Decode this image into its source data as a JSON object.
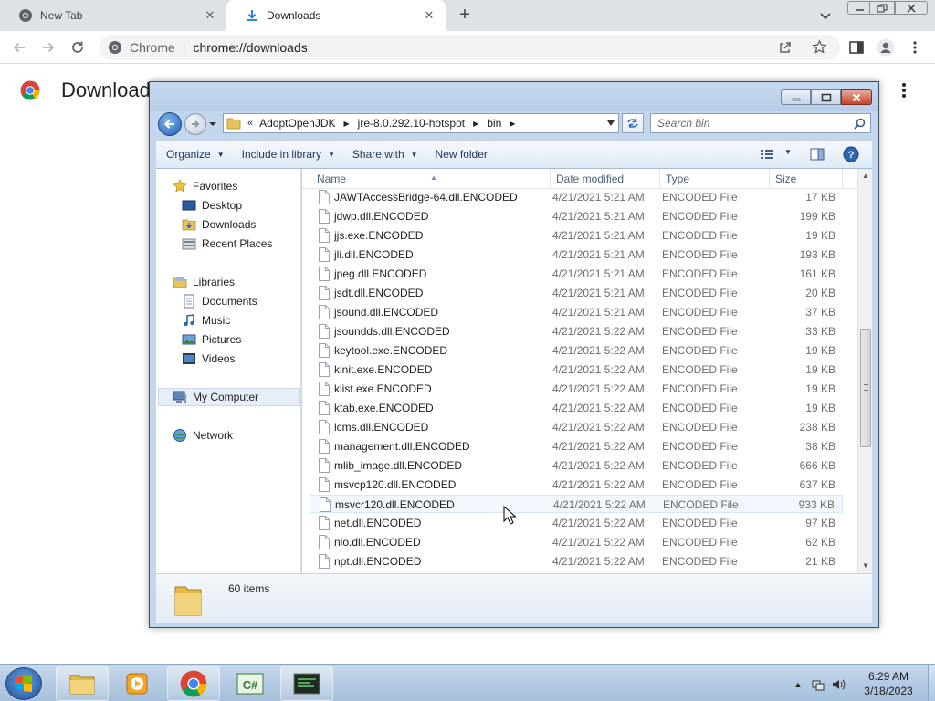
{
  "browser": {
    "tabs": [
      {
        "title": "New Tab",
        "state": "inactive"
      },
      {
        "title": "Downloads",
        "state": "active"
      }
    ],
    "omnibox": {
      "site_label": "Chrome",
      "separator": "|",
      "url": "chrome://downloads"
    }
  },
  "downloads_page": {
    "title": "Downloads"
  },
  "explorer": {
    "address": {
      "chevron": "«",
      "segments": [
        "AdoptOpenJDK",
        "jre-8.0.292.10-hotspot",
        "bin"
      ]
    },
    "search_placeholder": "Search bin",
    "commands": [
      {
        "label": "Organize",
        "has_menu": true
      },
      {
        "label": "Include in library",
        "has_menu": true
      },
      {
        "label": "Share with",
        "has_menu": true
      },
      {
        "label": "New folder",
        "has_menu": false
      }
    ],
    "nav": {
      "favorites": "Favorites",
      "desktop": "Desktop",
      "downloads": "Downloads",
      "recent": "Recent Places",
      "libraries": "Libraries",
      "documents": "Documents",
      "music": "Music",
      "pictures": "Pictures",
      "videos": "Videos",
      "computer": "My Computer",
      "network": "Network"
    },
    "columns": {
      "name": "Name",
      "date": "Date modified",
      "type": "Type",
      "size": "Size"
    },
    "files": [
      {
        "name": "JAWTAccessBridge-64.dll.ENCODED",
        "date": "4/21/2021 5:21 AM",
        "type": "ENCODED File",
        "size": "17 KB"
      },
      {
        "name": "jdwp.dll.ENCODED",
        "date": "4/21/2021 5:21 AM",
        "type": "ENCODED File",
        "size": "199 KB"
      },
      {
        "name": "jjs.exe.ENCODED",
        "date": "4/21/2021 5:21 AM",
        "type": "ENCODED File",
        "size": "19 KB"
      },
      {
        "name": "jli.dll.ENCODED",
        "date": "4/21/2021 5:21 AM",
        "type": "ENCODED File",
        "size": "193 KB"
      },
      {
        "name": "jpeg.dll.ENCODED",
        "date": "4/21/2021 5:21 AM",
        "type": "ENCODED File",
        "size": "161 KB"
      },
      {
        "name": "jsdt.dll.ENCODED",
        "date": "4/21/2021 5:21 AM",
        "type": "ENCODED File",
        "size": "20 KB"
      },
      {
        "name": "jsound.dll.ENCODED",
        "date": "4/21/2021 5:21 AM",
        "type": "ENCODED File",
        "size": "37 KB"
      },
      {
        "name": "jsoundds.dll.ENCODED",
        "date": "4/21/2021 5:22 AM",
        "type": "ENCODED File",
        "size": "33 KB"
      },
      {
        "name": "keytool.exe.ENCODED",
        "date": "4/21/2021 5:22 AM",
        "type": "ENCODED File",
        "size": "19 KB"
      },
      {
        "name": "kinit.exe.ENCODED",
        "date": "4/21/2021 5:22 AM",
        "type": "ENCODED File",
        "size": "19 KB"
      },
      {
        "name": "klist.exe.ENCODED",
        "date": "4/21/2021 5:22 AM",
        "type": "ENCODED File",
        "size": "19 KB"
      },
      {
        "name": "ktab.exe.ENCODED",
        "date": "4/21/2021 5:22 AM",
        "type": "ENCODED File",
        "size": "19 KB"
      },
      {
        "name": "lcms.dll.ENCODED",
        "date": "4/21/2021 5:22 AM",
        "type": "ENCODED File",
        "size": "238 KB"
      },
      {
        "name": "management.dll.ENCODED",
        "date": "4/21/2021 5:22 AM",
        "type": "ENCODED File",
        "size": "38 KB"
      },
      {
        "name": "mlib_image.dll.ENCODED",
        "date": "4/21/2021 5:22 AM",
        "type": "ENCODED File",
        "size": "666 KB"
      },
      {
        "name": "msvcp120.dll.ENCODED",
        "date": "4/21/2021 5:22 AM",
        "type": "ENCODED File",
        "size": "637 KB"
      },
      {
        "name": "msvcr120.dll.ENCODED",
        "date": "4/21/2021 5:22 AM",
        "type": "ENCODED File",
        "size": "933 KB",
        "hover": true
      },
      {
        "name": "net.dll.ENCODED",
        "date": "4/21/2021 5:22 AM",
        "type": "ENCODED File",
        "size": "97 KB"
      },
      {
        "name": "nio.dll.ENCODED",
        "date": "4/21/2021 5:22 AM",
        "type": "ENCODED File",
        "size": "62 KB"
      },
      {
        "name": "npt.dll.ENCODED",
        "date": "4/21/2021 5:22 AM",
        "type": "ENCODED File",
        "size": "21 KB"
      }
    ],
    "item_count": "60 items"
  },
  "taskbar": {
    "apps": [
      "file-explorer",
      "media-player",
      "chrome",
      "csharp-editor",
      "terminal"
    ],
    "clock": {
      "time": "6:29 AM",
      "date": "3/18/2023"
    }
  },
  "colors": {
    "chrome_frame": "#dee1e6",
    "explorer_frame": "#c2d7ed",
    "accent": "#1a73e8",
    "taskbar": "#b6cbe2"
  }
}
